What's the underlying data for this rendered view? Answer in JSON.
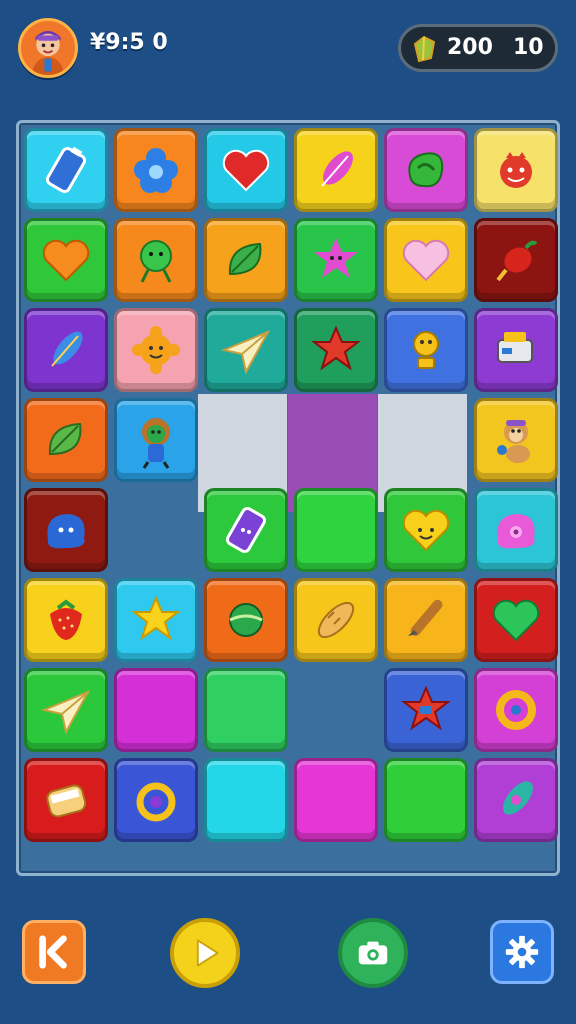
{
  "hud": {
    "timer": "¥9:5 0",
    "score": "200",
    "level": "10"
  },
  "colors": {
    "background": "#1d4f86",
    "board": "#3a6f9e"
  },
  "tiles": [
    {
      "row": 0,
      "col": 0,
      "color": "#2fd0f0",
      "icon": "battery-icon"
    },
    {
      "row": 0,
      "col": 1,
      "color": "#f7861e",
      "icon": "blue-flower-icon"
    },
    {
      "row": 0,
      "col": 2,
      "color": "#25c9e8",
      "icon": "red-heart-icon"
    },
    {
      "row": 0,
      "col": 3,
      "color": "#f7d21b",
      "icon": "pink-feather-icon"
    },
    {
      "row": 0,
      "col": 4,
      "color": "#d84bd6",
      "icon": "green-blob-icon"
    },
    {
      "row": 0,
      "col": 5,
      "color": "#f6e26a",
      "icon": "red-monster-icon"
    },
    {
      "row": 1,
      "col": 0,
      "color": "#2fc83a",
      "icon": "orange-heart-icon"
    },
    {
      "row": 1,
      "col": 1,
      "color": "#f6891c",
      "icon": "green-lollipop-icon"
    },
    {
      "row": 1,
      "col": 2,
      "color": "#f6a21a",
      "icon": "green-leaf-icon"
    },
    {
      "row": 1,
      "col": 3,
      "color": "#28c54a",
      "icon": "pink-star-creature-icon"
    },
    {
      "row": 1,
      "col": 4,
      "color": "#f8c61a",
      "icon": "pink-heart-icon"
    },
    {
      "row": 1,
      "col": 5,
      "color": "#8c1512",
      "icon": "red-pepper-icon"
    },
    {
      "row": 2,
      "col": 0,
      "color": "#7e35cf",
      "icon": "blue-feather-icon"
    },
    {
      "row": 2,
      "col": 1,
      "color": "#f5a3b0",
      "icon": "sun-face-icon"
    },
    {
      "row": 2,
      "col": 2,
      "color": "#1faa9a",
      "icon": "paper-plane-icon"
    },
    {
      "row": 2,
      "col": 3,
      "color": "#1f9e5c",
      "icon": "red-star-icon"
    },
    {
      "row": 2,
      "col": 4,
      "color": "#3f72e0",
      "icon": "gold-trophy-icon"
    },
    {
      "row": 2,
      "col": 5,
      "color": "#8d3bd2",
      "icon": "toy-robot-icon"
    },
    {
      "row": 3,
      "col": 0,
      "color": "#f26b1b",
      "icon": "leaf-icon"
    },
    {
      "row": 3,
      "col": 1,
      "color": "#2aa3e8",
      "icon": "lion-character-icon"
    },
    {
      "row": 3,
      "col": 5,
      "color": "#f3c51f",
      "icon": "monkey-character-icon"
    },
    {
      "row": 4,
      "col": 0,
      "color": "#8e1a12",
      "icon": "blue-blob-icon"
    },
    {
      "row": 4,
      "col": 2,
      "color": "#2bc93b",
      "icon": "purple-battery-icon"
    },
    {
      "row": 4,
      "col": 3,
      "color": "#2fd33f",
      "icon": "empty-tile"
    },
    {
      "row": 4,
      "col": 4,
      "color": "#2fc83a",
      "icon": "smiley-heart-icon"
    },
    {
      "row": 4,
      "col": 5,
      "color": "#2bc5d6",
      "icon": "pink-blob-icon"
    },
    {
      "row": 5,
      "col": 0,
      "color": "#f7d11b",
      "icon": "strawberry-icon"
    },
    {
      "row": 5,
      "col": 1,
      "color": "#2fc9f0",
      "icon": "yellow-star-icon"
    },
    {
      "row": 5,
      "col": 2,
      "color": "#f06b18",
      "icon": "green-ball-icon"
    },
    {
      "row": 5,
      "col": 3,
      "color": "#f7c61b",
      "icon": "bread-icon"
    },
    {
      "row": 5,
      "col": 4,
      "color": "#f7b51b",
      "icon": "brush-icon"
    },
    {
      "row": 5,
      "col": 5,
      "color": "#d41f1f",
      "icon": "green-heart-icon"
    },
    {
      "row": 6,
      "col": 0,
      "color": "#2bc83b",
      "icon": "paper-plane-icon"
    },
    {
      "row": 6,
      "col": 1,
      "color": "#d52fd8",
      "icon": "empty-tile"
    },
    {
      "row": 6,
      "col": 2,
      "color": "#2fcf62",
      "icon": "empty-tile"
    },
    {
      "row": 6,
      "col": 4,
      "color": "#3a64d6",
      "icon": "red-star-creature-icon"
    },
    {
      "row": 6,
      "col": 5,
      "color": "#d43fd5",
      "icon": "gold-ring-icon"
    },
    {
      "row": 7,
      "col": 0,
      "color": "#d81c1c",
      "icon": "toast-icon"
    },
    {
      "row": 7,
      "col": 1,
      "color": "#3a55d6",
      "icon": "purple-gem-ring-icon"
    },
    {
      "row": 7,
      "col": 2,
      "color": "#23d6e8",
      "icon": "empty-tile"
    },
    {
      "row": 7,
      "col": 3,
      "color": "#e636d6",
      "icon": "empty-tile"
    },
    {
      "row": 7,
      "col": 4,
      "color": "#2fcf3a",
      "icon": "empty-tile"
    },
    {
      "row": 7,
      "col": 5,
      "color": "#b13fd6",
      "icon": "teal-feather-icon"
    }
  ],
  "controls": {
    "back": "back-icon",
    "play": "play-icon",
    "camera": "camera-icon",
    "settings": "gear-icon"
  }
}
